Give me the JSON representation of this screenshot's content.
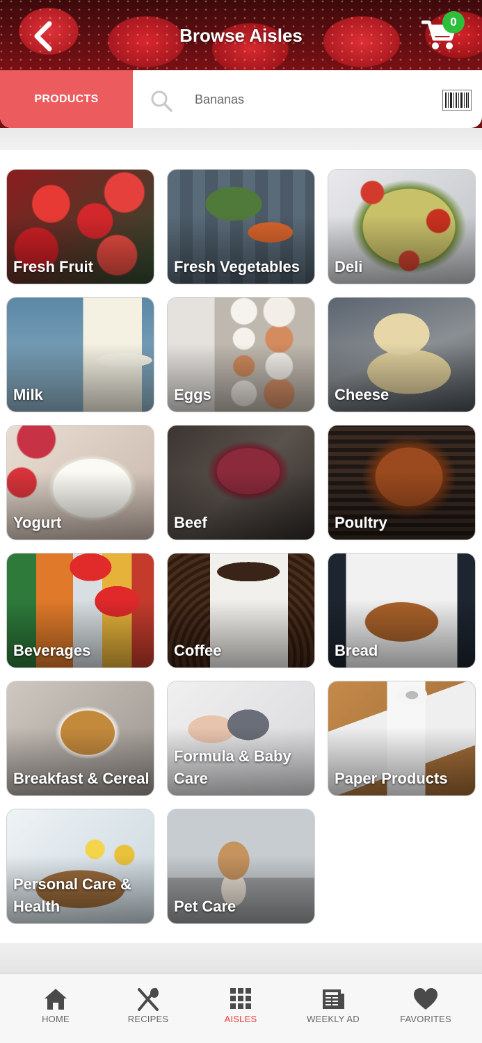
{
  "header": {
    "title": "Browse Aisles",
    "back_icon": "chevron-left-icon",
    "cart_icon": "cart-icon",
    "cart_count": "0"
  },
  "search": {
    "products_label": "PRODUCTS",
    "placeholder": "Bananas",
    "value": "",
    "search_icon": "search-icon",
    "barcode_icon": "barcode-icon"
  },
  "aisles": [
    {
      "label": "Fresh Fruit"
    },
    {
      "label": "Fresh Vegetables"
    },
    {
      "label": "Deli"
    },
    {
      "label": "Milk"
    },
    {
      "label": "Eggs"
    },
    {
      "label": "Cheese"
    },
    {
      "label": "Yogurt"
    },
    {
      "label": "Beef"
    },
    {
      "label": "Poultry"
    },
    {
      "label": "Beverages"
    },
    {
      "label": "Coffee"
    },
    {
      "label": "Bread"
    },
    {
      "label": "Breakfast & Cereal"
    },
    {
      "label": "Formula & Baby Care"
    },
    {
      "label": "Paper Products"
    },
    {
      "label": "Personal Care & Health"
    },
    {
      "label": "Pet Care"
    }
  ],
  "bottom_nav": [
    {
      "label": "HOME",
      "icon": "home-icon"
    },
    {
      "label": "RECIPES",
      "icon": "utensils-icon"
    },
    {
      "label": "AISLES",
      "icon": "grid-icon",
      "active": true
    },
    {
      "label": "WEEKLY AD",
      "icon": "newspaper-icon"
    },
    {
      "label": "FAVORITES",
      "icon": "heart-icon"
    }
  ],
  "colors": {
    "accent": "#ec5b5d",
    "active_nav": "#ec3b3b",
    "badge": "#2dbf3c"
  }
}
